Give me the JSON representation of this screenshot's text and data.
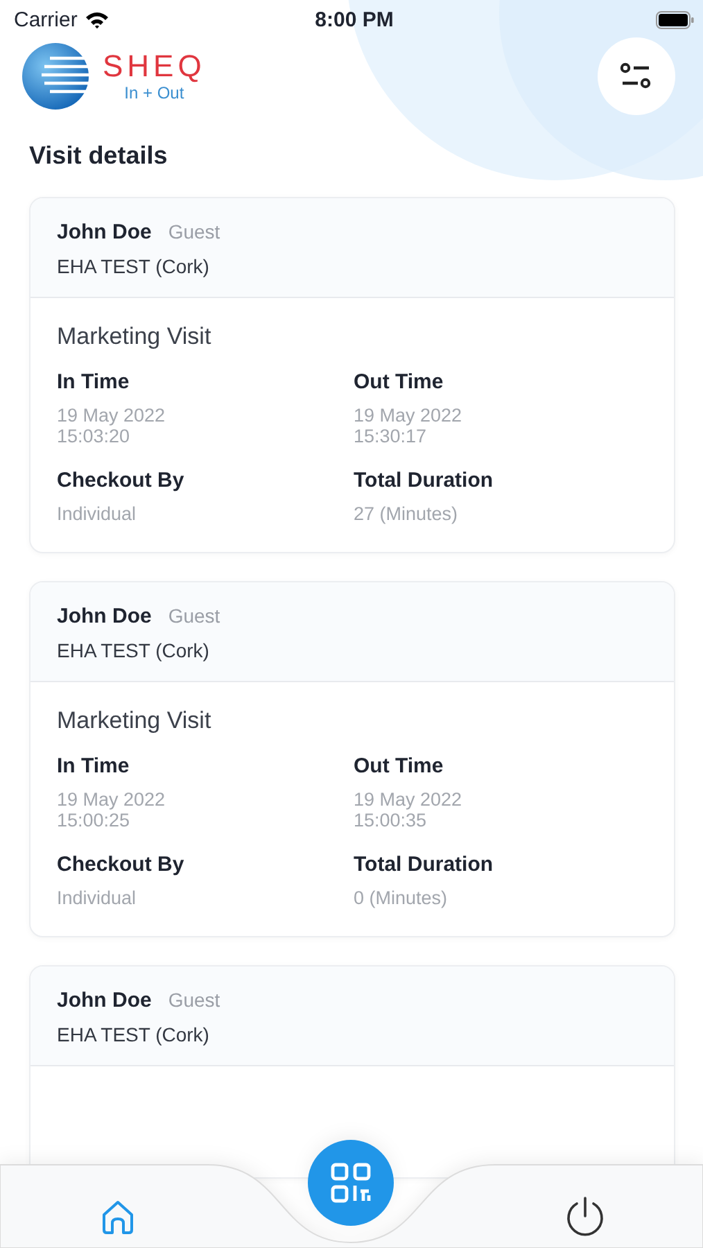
{
  "status_bar": {
    "carrier": "Carrier",
    "time": "8:00 PM"
  },
  "logo": {
    "name": "SHEQ",
    "tagline": "In + Out"
  },
  "title": "Visit details",
  "visits": [
    {
      "name": "John Doe",
      "role": "Guest",
      "location": "EHA TEST (Cork)",
      "purpose": "Marketing Visit",
      "fields": [
        {
          "label": "In Time",
          "value": "19 May 2022\n15:03:20"
        },
        {
          "label": "Out Time",
          "value": "19 May 2022\n15:30:17"
        },
        {
          "label": "Checkout By",
          "value": "Individual"
        },
        {
          "label": "Total Duration",
          "value": "27 (Minutes)"
        }
      ]
    },
    {
      "name": "John Doe",
      "role": "Guest",
      "location": "EHA TEST (Cork)",
      "purpose": "Marketing Visit",
      "fields": [
        {
          "label": "In Time",
          "value": "19 May 2022\n15:00:25"
        },
        {
          "label": "Out Time",
          "value": "19 May 2022\n15:00:35"
        },
        {
          "label": "Checkout By",
          "value": "Individual"
        },
        {
          "label": "Total Duration",
          "value": "0 (Minutes)"
        }
      ]
    },
    {
      "name": "John Doe",
      "role": "Guest",
      "location": "EHA TEST (Cork)"
    }
  ],
  "tab_bar": [
    {
      "kind": "home",
      "selected": true
    },
    {
      "kind": "scan",
      "selected": false
    },
    {
      "kind": "power",
      "selected": false
    }
  ]
}
